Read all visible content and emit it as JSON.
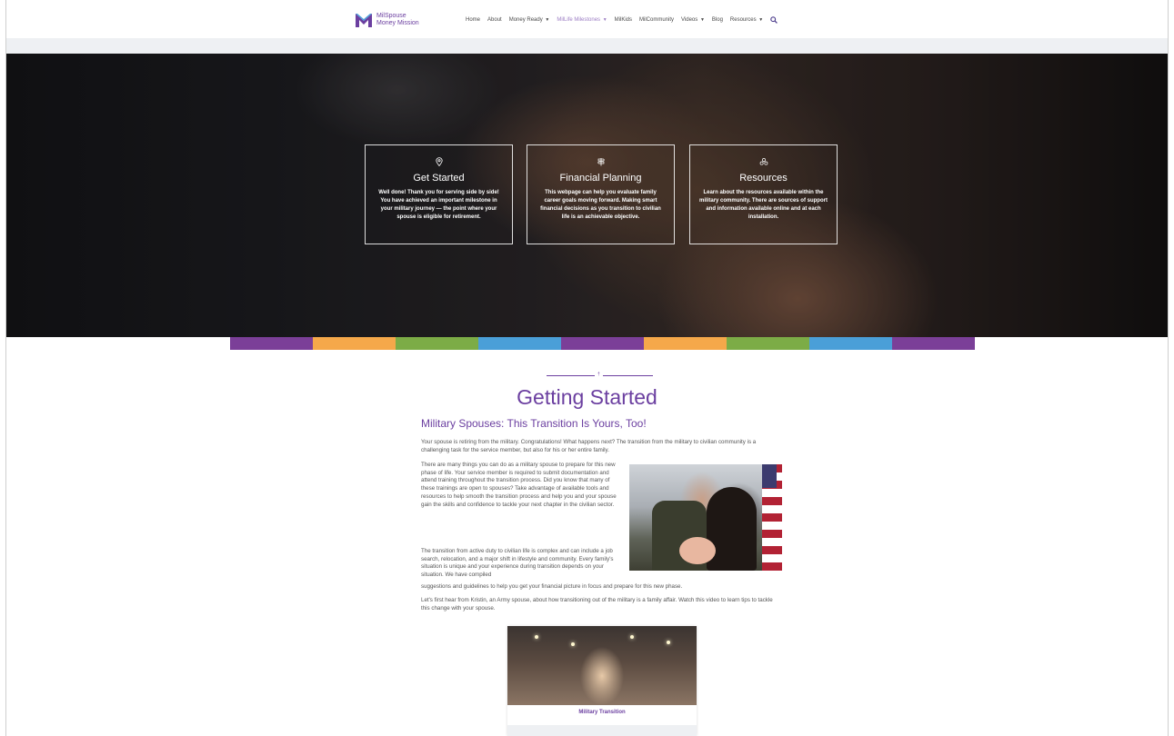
{
  "logo": {
    "line1": "MilSpouse",
    "line2": "Money Mission",
    "tagline": ""
  },
  "nav": {
    "items": [
      {
        "label": "Home",
        "dropdown": false,
        "active": false
      },
      {
        "label": "About",
        "dropdown": false,
        "active": false
      },
      {
        "label": "Money Ready",
        "dropdown": true,
        "active": false
      },
      {
        "label": "MilLife Milestones",
        "dropdown": true,
        "active": true
      },
      {
        "label": "MilKids",
        "dropdown": false,
        "active": false
      },
      {
        "label": "MilCommunity",
        "dropdown": false,
        "active": false
      },
      {
        "label": "Videos",
        "dropdown": true,
        "active": false
      },
      {
        "label": "Blog",
        "dropdown": false,
        "active": false
      },
      {
        "label": "Resources",
        "dropdown": true,
        "active": false
      }
    ],
    "caret": "▼",
    "search_icon": "search-icon"
  },
  "hero": {
    "cards": [
      {
        "icon": "map-pin-icon",
        "title": "Get Started",
        "text": "Well done! Thank you for serving side by side! You have achieved an important milestone in your military journey — the point where your spouse is eligible for retirement."
      },
      {
        "icon": "signpost-icon",
        "title": "Financial Planning",
        "text": "This webpage can help you evaluate family career goals moving forward. Making smart financial decisions as you transition to civilian life is an achievable objective."
      },
      {
        "icon": "community-icon",
        "title": "Resources",
        "text": "Learn about the resources available within the military community. There are sources of support and information available online and at each installation."
      }
    ]
  },
  "colors": {
    "brand_purple": "#6b3fa0",
    "stripe": [
      "#7b3f98",
      "#f5a84a",
      "#7cac46",
      "#4a9fd8",
      "#7b3f98",
      "#f5a84a",
      "#7cac46",
      "#4a9fd8",
      "#7b3f98"
    ]
  },
  "content": {
    "ornament_mark": "†",
    "title": "Getting Started",
    "subtitle": "Military Spouses: This Transition Is Yours, Too!",
    "p1": "Your spouse is retiring from the military. Congratulations! What happens next? The transition from the military to civilian community is a challenging task for the service member, but also for his or her entire family.",
    "p2": "There are many things you can do as a military spouse to prepare for this new phase of life. Your service member is required to submit documentation and attend training throughout the transition process. Did you know that many of these trainings are open to spouses? Take advantage of available tools and resources to help smooth the transition process and help you and your spouse gain the skills and confidence to tackle your next chapter in the civilian sector.",
    "p3": "The transition from active duty to civilian life is complex and can include a job search, relocation, and a major shift in lifestyle and community. Every family's situation is unique and your experience during transition depends on your situation. We have compiled",
    "p3b": "suggestions and guidelines to help you get your financial picture in focus and prepare for this new phase.",
    "p4": "Let's first hear from Kristin, an Army spouse, about how transitioning out of the military is a family affair. Watch this video to learn tips to tackle this change with your spouse.",
    "video_caption": "Military Transition"
  }
}
